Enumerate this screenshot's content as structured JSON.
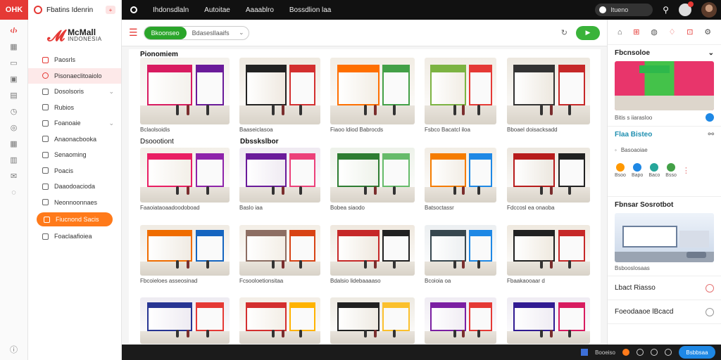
{
  "top": {
    "brand": "OHK",
    "app_title": "Fbatins Idenrin",
    "badge": "+",
    "links": [
      "Ihdonsdlaln",
      "Autoitae",
      "Aaaablro",
      "Bossdlion laa"
    ],
    "search_label": "Itueno",
    "notif_count": "1"
  },
  "sidebar": {
    "logo_main": "McMall",
    "logo_sub": "INDONESIA",
    "items": [
      {
        "label": "Paosrls",
        "icon": "home-icon"
      },
      {
        "label": "Pisonaeclitoaiolo",
        "icon": "search-icon"
      },
      {
        "label": "Dosolsoris",
        "icon": "tag-icon",
        "chevron": true
      },
      {
        "label": "Rubios",
        "icon": "doc-icon"
      },
      {
        "label": "Foanoaie",
        "icon": "bag-icon",
        "chevron": true
      },
      {
        "label": "Anaonacbooka",
        "icon": "box-icon"
      },
      {
        "label": "Senaoming",
        "icon": "gift-icon"
      },
      {
        "label": "Poacis",
        "icon": "edit-icon"
      },
      {
        "label": "Daaodoacioda",
        "icon": "list-icon"
      },
      {
        "label": "Neonnoonnaes",
        "icon": "card-icon"
      },
      {
        "label": "Fiucnond Sacis",
        "icon": "star-icon"
      },
      {
        "label": "Foaclaafioiea",
        "icon": "file-icon"
      }
    ]
  },
  "toolbar": {
    "filter_tag": "Bkoonseo",
    "filter_value": "Bdasesllaaifs"
  },
  "grid": {
    "section1": "Pionomiem",
    "section2": "Dsoootiont",
    "section3": "Dbsskslbor",
    "rows": [
      [
        "Bclaolsoidis",
        "Baaseiclasoa",
        "Fiaoo ldiod Babrocds",
        "Fsbco Bacatcl iloa",
        "Bboael doisacksadd"
      ],
      [
        "Faaoiataoaadoodoboad",
        "Baslo iaa",
        "Bobea siaodo",
        "Batsoctassr",
        "Fdccosl ea onaoba"
      ],
      [
        "Fbcoieloes asseosinad",
        "Fcsooloetionsitaa",
        "Bdalsio lidebaaaaso",
        "Bcoioia oa",
        "Fbaakaooaar d"
      ],
      [
        "",
        "",
        "",
        "",
        ""
      ]
    ]
  },
  "right": {
    "block1_title": "Fbcnsoloe",
    "block1_caption": "Bitis s iiarasloo",
    "block2_title": "Flaa Bisteo",
    "block2_meta": "Basoaoiae",
    "chips": [
      "Bsoo",
      "Bapo",
      "Baco",
      "Bsso"
    ],
    "block3_title": "Fbnsar Sosrotbot",
    "block3_caption": "Bsbooslosaas",
    "row1": "Lbact Riasso",
    "row2": "Foeodaaoe lBcacd"
  },
  "bottom": {
    "item1": "Booeiso",
    "button": "Bsbbsaa"
  }
}
